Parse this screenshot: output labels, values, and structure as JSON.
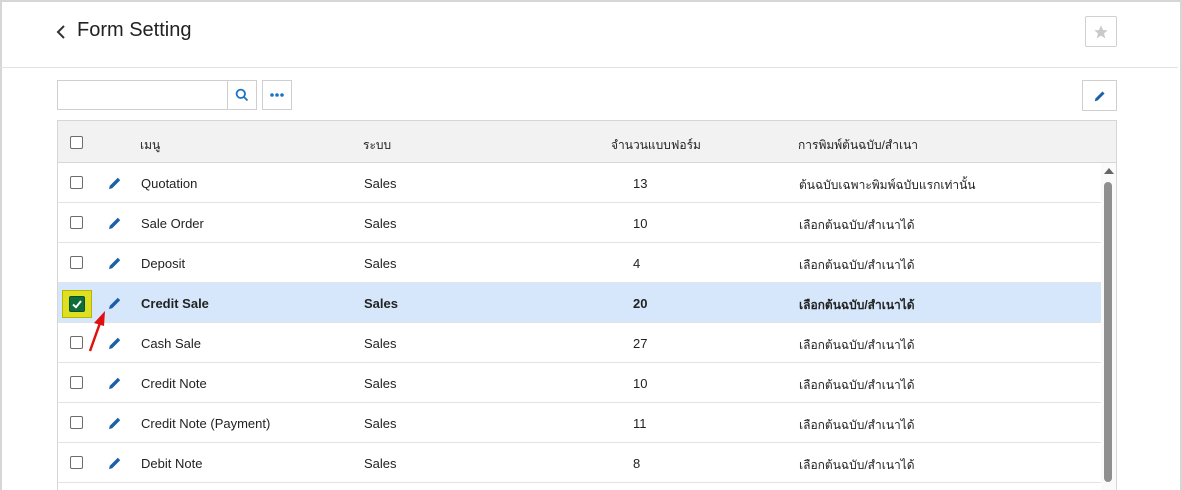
{
  "header": {
    "title": "Form Setting"
  },
  "toolbar": {
    "search_value": "",
    "search_placeholder": ""
  },
  "table": {
    "columns": [
      "เมนู",
      "ระบบ",
      "จำนวนแบบฟอร์ม",
      "การพิมพ์ต้นฉบับ/สำเนา"
    ],
    "rows": [
      {
        "menu": "Quotation",
        "system": "Sales",
        "count": "13",
        "print": "ต้นฉบับเฉพาะพิมพ์ฉบับแรกเท่านั้น",
        "checked": false
      },
      {
        "menu": "Sale Order",
        "system": "Sales",
        "count": "10",
        "print": "เลือกต้นฉบับ/สำเนาได้",
        "checked": false
      },
      {
        "menu": "Deposit",
        "system": "Sales",
        "count": "4",
        "print": "เลือกต้นฉบับ/สำเนาได้",
        "checked": false
      },
      {
        "menu": "Credit Sale",
        "system": "Sales",
        "count": "20",
        "print": "เลือกต้นฉบับ/สำเนาได้",
        "checked": true
      },
      {
        "menu": "Cash Sale",
        "system": "Sales",
        "count": "27",
        "print": "เลือกต้นฉบับ/สำเนาได้",
        "checked": false
      },
      {
        "menu": "Credit Note",
        "system": "Sales",
        "count": "10",
        "print": "เลือกต้นฉบับ/สำเนาได้",
        "checked": false
      },
      {
        "menu": "Credit Note (Payment)",
        "system": "Sales",
        "count": "11",
        "print": "เลือกต้นฉบับ/สำเนาได้",
        "checked": false
      },
      {
        "menu": "Debit Note",
        "system": "Sales",
        "count": "8",
        "print": "เลือกต้นฉบับ/สำเนาได้",
        "checked": false
      }
    ]
  },
  "colors": {
    "accent": "#1a73c8",
    "selected_row": "#d6e7fb",
    "checkbox_highlight": "#dede22",
    "annotation_arrow": "#e01010"
  },
  "icons": [
    "chevron-left-icon",
    "star-icon",
    "search-icon",
    "more-icon",
    "pencil-icon",
    "checkmark-icon",
    "annotation-arrow"
  ]
}
